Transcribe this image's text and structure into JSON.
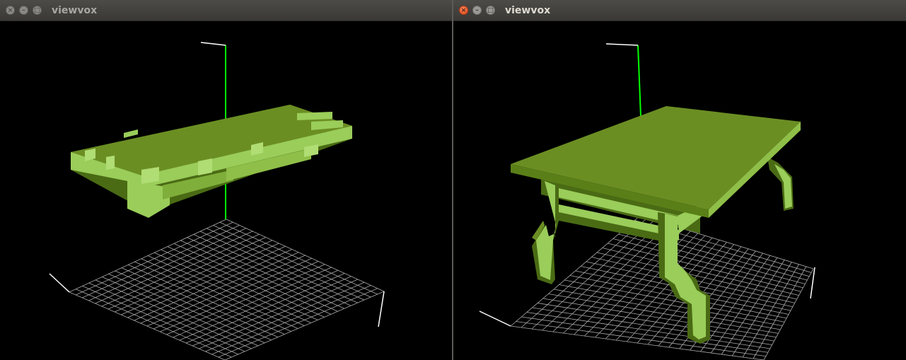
{
  "windows": [
    {
      "title": "viewvox",
      "state": "inactive",
      "buttons": [
        "close",
        "minimize",
        "maximize"
      ],
      "content": "voxel-model-flat-slab"
    },
    {
      "title": "viewvox",
      "state": "active",
      "buttons": [
        "close",
        "minimize",
        "maximize"
      ],
      "content": "voxel-model-table"
    }
  ],
  "colors": {
    "voxel_top": "#6b8e23",
    "voxel_side_light": "#9acd5a",
    "voxel_side_dark": "#4a6b14",
    "axis_green": "#00ff00",
    "axis_white": "#ffffff",
    "grid": "#c8c8c8",
    "close_button": "#e2471a",
    "viewport_bg": "#000000"
  },
  "icons": {
    "close": "close-icon",
    "minimize": "minimize-icon",
    "maximize": "maximize-icon"
  }
}
